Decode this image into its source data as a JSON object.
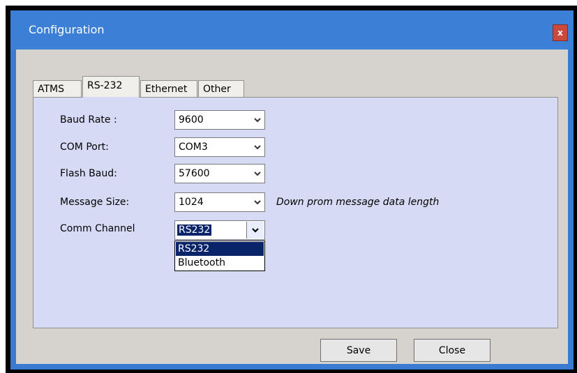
{
  "window": {
    "title": "Configuration",
    "close_label": "x"
  },
  "tabs": [
    {
      "label": "ATMS",
      "active": false
    },
    {
      "label": "RS-232",
      "active": true
    },
    {
      "label": "Ethernet",
      "active": false
    },
    {
      "label": "Other",
      "active": false
    }
  ],
  "form": {
    "baud_rate": {
      "label": "Baud Rate :",
      "value": "9600"
    },
    "com_port": {
      "label": "COM Port:",
      "value": "COM3"
    },
    "flash_baud": {
      "label": "Flash Baud:",
      "value": "57600"
    },
    "message_size": {
      "label": "Message Size:",
      "value": "1024",
      "hint": "Down prom message data length"
    },
    "comm_channel": {
      "label": "Comm Channel",
      "value": "RS232",
      "options": [
        "RS232",
        "Bluetooth"
      ],
      "selected_index": 0
    }
  },
  "buttons": {
    "save": "Save",
    "close": "Close"
  },
  "colors": {
    "title_bar": "#3b7fd6",
    "panel": "#d6daf5",
    "selection": "#0a246a",
    "close_button": "#c94a3a"
  }
}
